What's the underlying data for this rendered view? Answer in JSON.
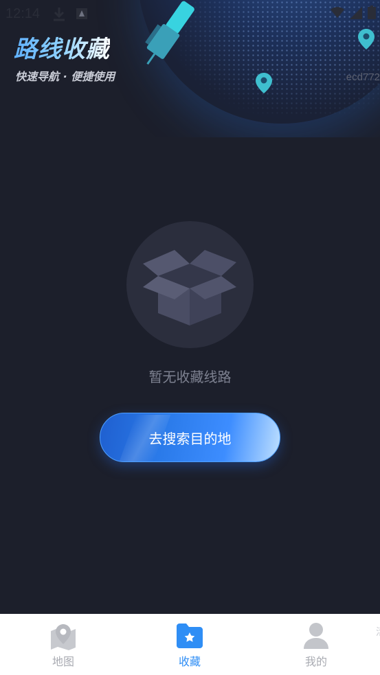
{
  "status_bar": {
    "time": "12:14",
    "icons": [
      "download-icon",
      "notification-icon",
      "wifi-icon",
      "signal-icon",
      "battery-icon"
    ]
  },
  "header": {
    "title": "路线收藏",
    "subtitle": "快速导航 · 便捷使用",
    "device_id": "ecd772"
  },
  "empty_state": {
    "icon": "empty-box-icon",
    "message": "暂无收藏线路",
    "button_label": "去搜索目的地"
  },
  "tabbar": {
    "items": [
      {
        "label": "地图",
        "icon": "map-pin-icon",
        "active": false
      },
      {
        "label": "收藏",
        "icon": "folder-star-icon",
        "active": true
      },
      {
        "label": "我的",
        "icon": "person-icon",
        "active": false
      }
    ],
    "edge_partial": "活"
  },
  "colors": {
    "background": "#1c1f2b",
    "accent": "#2f8ef5",
    "inactive": "#a9abb2"
  }
}
